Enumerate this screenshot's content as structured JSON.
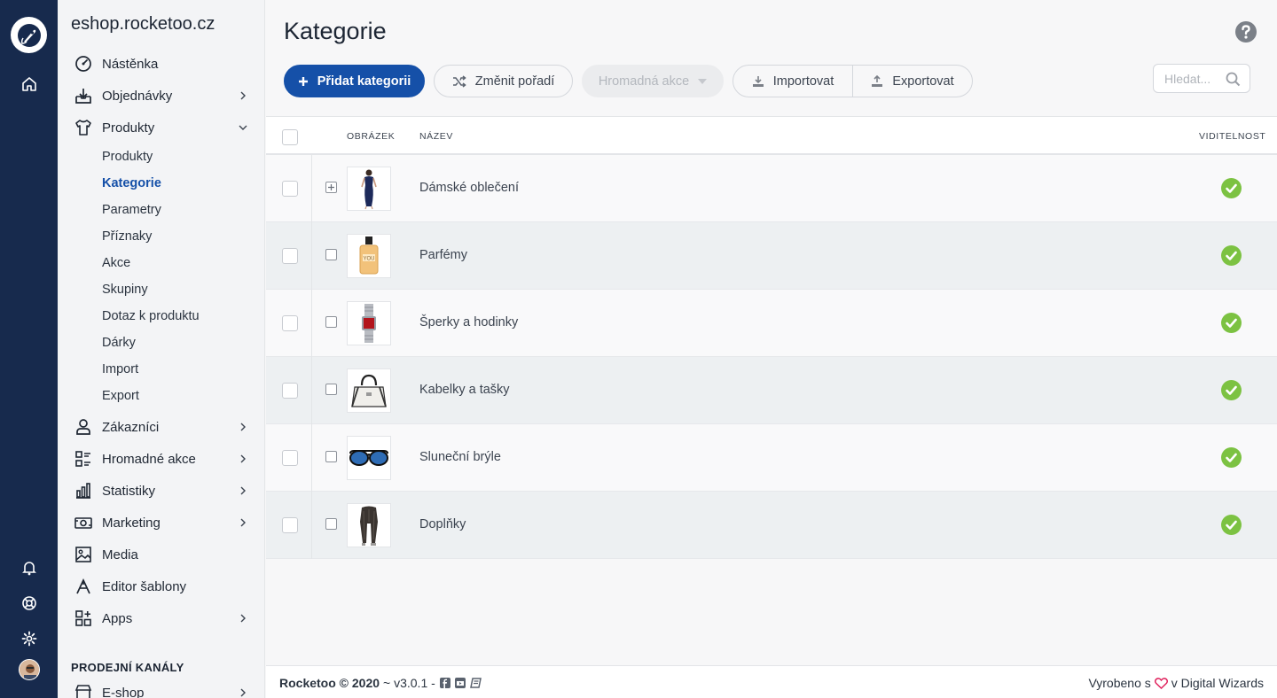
{
  "rail": {
    "icons": [
      "rocket-logo-icon",
      "home-icon",
      "bell-icon",
      "lifebuoy-icon",
      "gear-icon",
      "avatar"
    ]
  },
  "sidebar": {
    "shop_title": "eshop.rocketoo.cz",
    "items": [
      {
        "label": "Nástěnka",
        "icon": "dashboard-icon",
        "chevron": false
      },
      {
        "label": "Objednávky",
        "icon": "orders-icon",
        "chevron": true
      },
      {
        "label": "Produkty",
        "icon": "shirt-icon",
        "chevron": true,
        "expanded": true
      }
    ],
    "sub_items": [
      "Produkty",
      "Kategorie",
      "Parametry",
      "Příznaky",
      "Akce",
      "Skupiny",
      "Dotaz k produktu",
      "Dárky",
      "Import",
      "Export"
    ],
    "active_sub": "Kategorie",
    "items_after": [
      {
        "label": "Zákazníci",
        "icon": "user-icon",
        "chevron": true
      },
      {
        "label": "Hromadné akce",
        "icon": "bulk-icon",
        "chevron": true
      },
      {
        "label": "Statistiky",
        "icon": "stats-icon",
        "chevron": true
      },
      {
        "label": "Marketing",
        "icon": "marketing-icon",
        "chevron": true
      },
      {
        "label": "Media",
        "icon": "image-icon",
        "chevron": false
      },
      {
        "label": "Editor šablony",
        "icon": "editor-icon",
        "chevron": false
      },
      {
        "label": "Apps",
        "icon": "apps-icon",
        "chevron": true
      }
    ],
    "section_label": "PRODEJNÍ KANÁLY",
    "channel_item": {
      "label": "E-shop",
      "icon": "store-icon",
      "chevron": true
    }
  },
  "main": {
    "title": "Kategorie",
    "toolbar": {
      "add_label": "Přidat kategorii",
      "reorder_label": "Změnit pořadí",
      "bulk_label": "Hromadná akce",
      "import_label": "Importovat",
      "export_label": "Exportovat"
    },
    "search": {
      "placeholder": "Hledat...",
      "value": ""
    },
    "table": {
      "headers": {
        "image": "OBRÁZEK",
        "name": "NÁZEV",
        "visibility": "VIDITELNOST"
      },
      "rows": [
        {
          "name": "Dámské oblečení",
          "expandable": true,
          "thumb": "dress",
          "visible": true
        },
        {
          "name": "Parfémy",
          "expandable": false,
          "thumb": "perfume",
          "visible": true
        },
        {
          "name": "Šperky a hodinky",
          "expandable": false,
          "thumb": "watch",
          "visible": true
        },
        {
          "name": "Kabelky a tašky",
          "expandable": false,
          "thumb": "handbag",
          "visible": true
        },
        {
          "name": "Sluneční brýle",
          "expandable": false,
          "thumb": "sunglasses",
          "visible": true
        },
        {
          "name": "Doplňky",
          "expandable": false,
          "thumb": "scarf",
          "visible": true
        }
      ]
    }
  },
  "footer": {
    "brand": "Rocketoo © 2020",
    "version": "~ v3.0.1 -",
    "made_prefix": "Vyrobeno s",
    "made_suffix": "v Digital Wizards"
  },
  "colors": {
    "primary": "#1550a8",
    "rail": "#172a4d",
    "success": "#7cc242",
    "heart": "#e0245e"
  }
}
